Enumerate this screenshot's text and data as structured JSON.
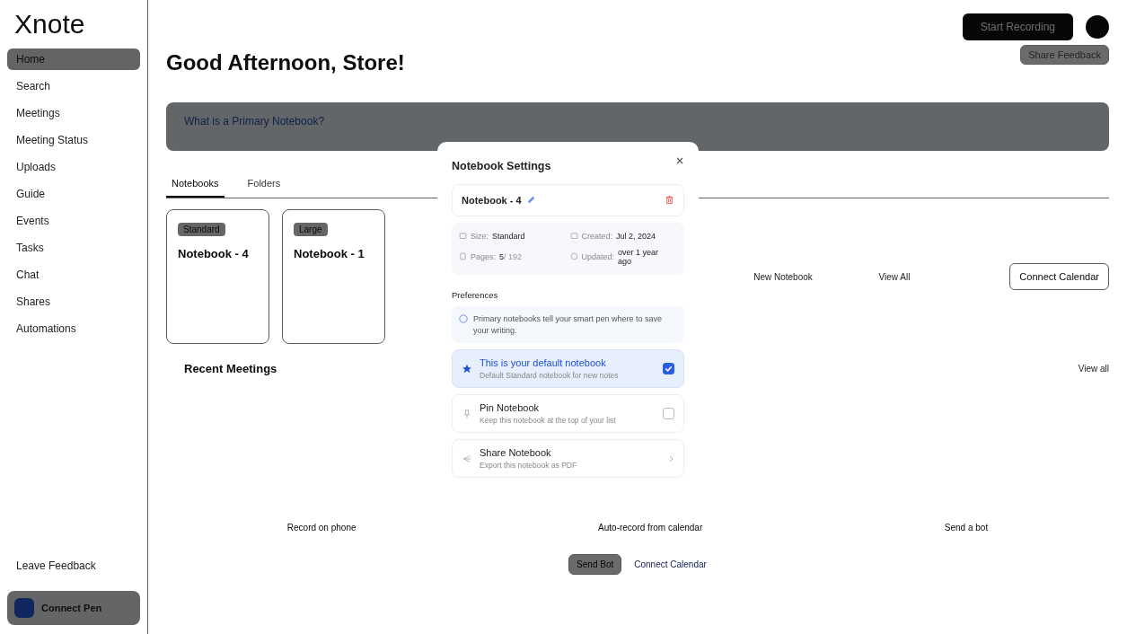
{
  "brand": {
    "logo": "Xnote"
  },
  "sidebar": {
    "items": [
      {
        "label": "Home",
        "selected": true
      },
      {
        "label": "Search",
        "selected": false
      },
      {
        "label": "Meetings",
        "selected": false
      },
      {
        "label": "Meeting Status",
        "selected": false
      },
      {
        "label": "Uploads",
        "selected": false
      },
      {
        "label": "Guide",
        "selected": false
      },
      {
        "label": "Events",
        "selected": false
      },
      {
        "label": "Tasks",
        "selected": false
      },
      {
        "label": "Chat",
        "selected": false
      },
      {
        "label": "Shares",
        "selected": false
      },
      {
        "label": "Automations",
        "selected": false
      }
    ],
    "feedback": "Leave Feedback",
    "pen": "Connect Pen"
  },
  "topbar": {
    "record": "Start Recording"
  },
  "header": {
    "greeting": "Good Afternoon, Store!",
    "feedback": "Share Feedback"
  },
  "banner": {
    "title": "What is a Primary Notebook?"
  },
  "tabs": [
    {
      "label": "Notebooks",
      "selected": true
    },
    {
      "label": "Folders",
      "selected": false
    }
  ],
  "notebooks": [
    {
      "size": "Standard",
      "name": "Notebook - 4"
    },
    {
      "size": "Large",
      "name": "Notebook - 1"
    }
  ],
  "actions": [
    "New Notebook",
    "View All"
  ],
  "calendar_chip": "Connect Calendar",
  "recent": {
    "title": "Recent Meetings",
    "view_all": "View all",
    "options": [
      "Record on phone",
      "Auto-record from calendar",
      "Send a bot"
    ],
    "send_bot": "Send Bot",
    "connect": "Connect Calendar"
  },
  "modal": {
    "title": "Notebook Settings",
    "notebook_name": "Notebook - 4",
    "info": [
      {
        "label": "Size:",
        "value": "Standard"
      },
      {
        "label": "Created:",
        "value": "Jul 2, 2024"
      },
      {
        "label": "Pages:",
        "value": "5",
        "extra": "/ 192"
      },
      {
        "label": "Updated:",
        "value": "over 1 year ago"
      }
    ],
    "preferences_heading": "Preferences",
    "hint": "Primary notebooks tell your smart pen where to save your writing.",
    "options": [
      {
        "kind": "checkbox",
        "title": "This is your default notebook",
        "subtitle": "Default Standard notebook for new notes",
        "checked": true
      },
      {
        "kind": "checkbox",
        "title": "Pin Notebook",
        "subtitle": "Keep this notebook at the top of your list",
        "checked": false
      },
      {
        "kind": "link",
        "title": "Share Notebook",
        "subtitle": "Export this notebook as PDF"
      }
    ]
  }
}
